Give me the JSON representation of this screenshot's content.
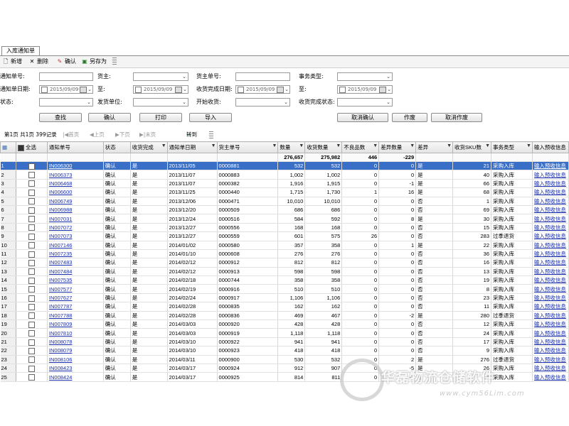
{
  "tab": {
    "label": "入库通知单"
  },
  "toolbar": {
    "new": "新增",
    "delete": "删除",
    "confirm": "确认",
    "save_as": "另存为"
  },
  "filters": {
    "notice_no": "通知单号:",
    "owner": "货主:",
    "owner_order_no": "货主单号:",
    "business_type": "事务类型:",
    "notice_date": "通知单日期:",
    "to1": "至:",
    "finish_date": "收货完成日期:",
    "to2": "至:",
    "status": "状态:",
    "supplier": "发货单位:",
    "start_receive": "开始收货:",
    "finish_status": "收货完成状态:",
    "date_value": "2015/09/09"
  },
  "actions": {
    "search": "查找",
    "confirm": "确认",
    "print": "打印",
    "import": "导入",
    "cancel_confirm": "取消确认",
    "void": "作废",
    "cancel_void": "取消作废"
  },
  "pager": {
    "info": "第1页 共1页 399记录",
    "first": "首页",
    "prev": "上页",
    "next": "下页",
    "last": "末页",
    "goto": "转到"
  },
  "grid": {
    "select_all": "全选",
    "columns": [
      "通知单号",
      "状态",
      "收货完成",
      "通知单日期",
      "货主单号",
      "数量",
      "收货数量",
      "不良品数",
      "差异数量",
      "差异",
      "收货SKU数",
      "事务类型",
      "输入预收信息"
    ],
    "summary": {
      "qty": "276,657",
      "recv": "275,982",
      "bad": "446",
      "diff": "-229"
    },
    "rows": [
      {
        "n": "1",
        "no": "IN006300",
        "st": "确认",
        "done": "是",
        "date": "2013/11/05",
        "ono": "0000881",
        "qty": "532",
        "recv": "532",
        "bad": "0",
        "diff": "0",
        "df": "是",
        "sku": "21",
        "type": "采购入库",
        "link": "输入预收信息"
      },
      {
        "n": "2",
        "no": "IN006373",
        "st": "确认",
        "done": "是",
        "date": "2013/11/07",
        "ono": "0000883",
        "qty": "1,002",
        "recv": "1,002",
        "bad": "0",
        "diff": "0",
        "df": "是",
        "sku": "40",
        "type": "采购入库",
        "link": "输入预收信息"
      },
      {
        "n": "3",
        "no": "IN006468",
        "st": "确认",
        "done": "是",
        "date": "2013/11/07",
        "ono": "0000382",
        "qty": "1,916",
        "recv": "1,915",
        "bad": "0",
        "diff": "-1",
        "df": "是",
        "sku": "66",
        "type": "采购入库",
        "link": "输入预收信息"
      },
      {
        "n": "4",
        "no": "IN006600",
        "st": "确认",
        "done": "是",
        "date": "2013/11/25",
        "ono": "0000440",
        "qty": "1,715",
        "recv": "1,730",
        "bad": "1",
        "diff": "16",
        "df": "是",
        "sku": "68",
        "type": "采购入库",
        "link": "输入预收信息"
      },
      {
        "n": "5",
        "no": "IN006749",
        "st": "确认",
        "done": "是",
        "date": "2013/12/06",
        "ono": "0000471",
        "qty": "10,010",
        "recv": "10,010",
        "bad": "0",
        "diff": "0",
        "df": "否",
        "sku": "1",
        "type": "采购入库",
        "link": "输入预收信息"
      },
      {
        "n": "6",
        "no": "IN006988",
        "st": "确认",
        "done": "是",
        "date": "2013/12/20",
        "ono": "0000509",
        "qty": "686",
        "recv": "686",
        "bad": "0",
        "diff": "0",
        "df": "否",
        "sku": "69",
        "type": "采购入库",
        "link": "输入预收信息"
      },
      {
        "n": "7",
        "no": "IN007031",
        "st": "确认",
        "done": "是",
        "date": "2013/12/24",
        "ono": "0000516",
        "qty": "584",
        "recv": "592",
        "bad": "0",
        "diff": "8",
        "df": "是",
        "sku": "30",
        "type": "采购入库",
        "link": "输入预收信息"
      },
      {
        "n": "8",
        "no": "IN007072",
        "st": "确认",
        "done": "是",
        "date": "2013/12/27",
        "ono": "0000556",
        "qty": "168",
        "recv": "168",
        "bad": "0",
        "diff": "0",
        "df": "否",
        "sku": "15",
        "type": "采购入库",
        "link": "输入预收信息"
      },
      {
        "n": "9",
        "no": "IN007073",
        "st": "确认",
        "done": "是",
        "date": "2013/12/27",
        "ono": "0000559",
        "qty": "601",
        "recv": "575",
        "bad": "26",
        "diff": "0",
        "df": "否",
        "sku": "283",
        "type": "过季退货",
        "link": "输入预收信息"
      },
      {
        "n": "10",
        "no": "IN007146",
        "st": "确认",
        "done": "是",
        "date": "2014/01/02",
        "ono": "0000580",
        "qty": "357",
        "recv": "358",
        "bad": "0",
        "diff": "1",
        "df": "是",
        "sku": "22",
        "type": "采购入库",
        "link": "输入预收信息"
      },
      {
        "n": "11",
        "no": "IN007235",
        "st": "确认",
        "done": "是",
        "date": "2014/01/10",
        "ono": "0000608",
        "qty": "276",
        "recv": "276",
        "bad": "0",
        "diff": "0",
        "df": "否",
        "sku": "36",
        "type": "采购入库",
        "link": "输入预收信息"
      },
      {
        "n": "12",
        "no": "IN007483",
        "st": "确认",
        "done": "是",
        "date": "2014/02/12",
        "ono": "0000912",
        "qty": "812",
        "recv": "812",
        "bad": "0",
        "diff": "0",
        "df": "否",
        "sku": "16",
        "type": "采购入库",
        "link": "输入预收信息"
      },
      {
        "n": "13",
        "no": "IN007484",
        "st": "确认",
        "done": "是",
        "date": "2014/02/12",
        "ono": "0000913",
        "qty": "598",
        "recv": "598",
        "bad": "0",
        "diff": "0",
        "df": "否",
        "sku": "13",
        "type": "采购入库",
        "link": "输入预收信息"
      },
      {
        "n": "14",
        "no": "IN007535",
        "st": "确认",
        "done": "是",
        "date": "2014/02/18",
        "ono": "0000744",
        "qty": "358",
        "recv": "358",
        "bad": "0",
        "diff": "0",
        "df": "否",
        "sku": "19",
        "type": "采购入库",
        "link": "输入预收信息"
      },
      {
        "n": "15",
        "no": "IN007577",
        "st": "确认",
        "done": "是",
        "date": "2014/02/19",
        "ono": "0000916",
        "qty": "510",
        "recv": "510",
        "bad": "0",
        "diff": "0",
        "df": "否",
        "sku": "8",
        "type": "采购入库",
        "link": "输入预收信息"
      },
      {
        "n": "16",
        "no": "IN007627",
        "st": "确认",
        "done": "是",
        "date": "2014/02/24",
        "ono": "0000917",
        "qty": "1,106",
        "recv": "1,106",
        "bad": "0",
        "diff": "0",
        "df": "否",
        "sku": "23",
        "type": "采购入库",
        "link": "输入预收信息"
      },
      {
        "n": "17",
        "no": "IN007787",
        "st": "确认",
        "done": "是",
        "date": "2014/02/28",
        "ono": "0000835",
        "qty": "162",
        "recv": "162",
        "bad": "0",
        "diff": "0",
        "df": "否",
        "sku": "11",
        "type": "采购入库",
        "link": "输入预收信息"
      },
      {
        "n": "18",
        "no": "IN007788",
        "st": "确认",
        "done": "是",
        "date": "2014/02/28",
        "ono": "0000836",
        "qty": "469",
        "recv": "467",
        "bad": "0",
        "diff": "-2",
        "df": "是",
        "sku": "280",
        "type": "过季退货",
        "link": "输入预收信息"
      },
      {
        "n": "19",
        "no": "IN007809",
        "st": "确认",
        "done": "是",
        "date": "2014/03/03",
        "ono": "0000920",
        "qty": "428",
        "recv": "428",
        "bad": "0",
        "diff": "0",
        "df": "否",
        "sku": "12",
        "type": "采购入库",
        "link": "输入预收信息"
      },
      {
        "n": "20",
        "no": "IN007810",
        "st": "确认",
        "done": "是",
        "date": "2014/03/03",
        "ono": "0000919",
        "qty": "1,118",
        "recv": "1,118",
        "bad": "0",
        "diff": "0",
        "df": "否",
        "sku": "24",
        "type": "采购入库",
        "link": "输入预收信息"
      },
      {
        "n": "21",
        "no": "IN008078",
        "st": "确认",
        "done": "是",
        "date": "2014/03/10",
        "ono": "0000922",
        "qty": "941",
        "recv": "941",
        "bad": "0",
        "diff": "0",
        "df": "否",
        "sku": "17",
        "type": "采购入库",
        "link": "输入预收信息"
      },
      {
        "n": "22",
        "no": "IN008079",
        "st": "确认",
        "done": "是",
        "date": "2014/03/10",
        "ono": "0000923",
        "qty": "418",
        "recv": "418",
        "bad": "0",
        "diff": "0",
        "df": "否",
        "sku": "9",
        "type": "采购入库",
        "link": "输入预收信息"
      },
      {
        "n": "23",
        "no": "IN008106",
        "st": "确认",
        "done": "是",
        "date": "2014/03/11",
        "ono": "0000900",
        "qty": "530",
        "recv": "532",
        "bad": "0",
        "diff": "2",
        "df": "是",
        "sku": "276",
        "type": "过季退货",
        "link": "输入预收信息"
      },
      {
        "n": "24",
        "no": "IN008423",
        "st": "确认",
        "done": "是",
        "date": "2014/03/17",
        "ono": "0000924",
        "qty": "912",
        "recv": "907",
        "bad": "0",
        "diff": "-5",
        "df": "是",
        "sku": "26",
        "type": "采购入库",
        "link": "输入预收信息"
      },
      {
        "n": "25",
        "no": "IN008424",
        "st": "确认",
        "done": "是",
        "date": "2014/03/17",
        "ono": "0000925",
        "qty": "814",
        "recv": "811",
        "bad": "0",
        "diff": "-3",
        "df": "是",
        "sku": "34",
        "type": "采购入库",
        "link": "输入预收信息"
      }
    ]
  },
  "watermark": {
    "text": "华磊物流仓储软件",
    "url": "www.cym56Lim.com"
  }
}
